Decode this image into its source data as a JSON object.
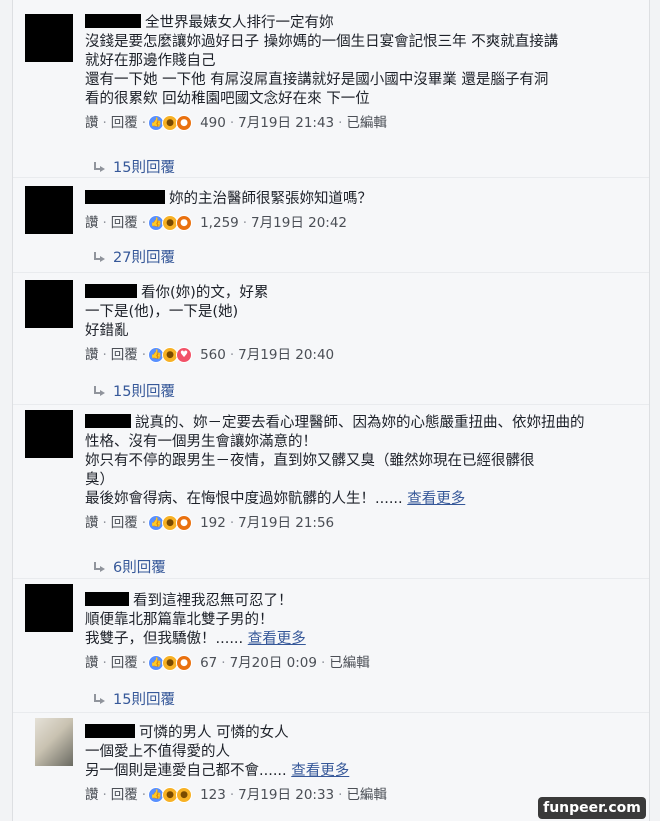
{
  "comments": [
    {
      "lines": [
        "全世界最婊女人排行一定有妳",
        "沒錢是要怎麼讓妳過好日子 操妳媽的一個生日宴會記恨三年 不爽就直接講",
        "就好在那邊作賤自己",
        "還有一下她 一下他 有屌沒屌直接講就好是國小國中沒畢業 還是腦子有洞",
        "看的很累欸 回幼稚園吧國文念好在來 下一位"
      ],
      "actions": {
        "like": "讚",
        "reply": "回覆",
        "count": "490",
        "time": "7月19日 21:43",
        "edited": "已編輯"
      },
      "reactions": [
        "like",
        "haha",
        "angry"
      ],
      "replies": "15則回覆"
    },
    {
      "lines": [
        "妳的主治醫師很緊張妳知道嗎？"
      ],
      "actions": {
        "like": "讚",
        "reply": "回覆",
        "count": "1,259",
        "time": "7月19日 20:42",
        "edited": ""
      },
      "reactions": [
        "like",
        "haha",
        "angry"
      ],
      "replies": "27則回覆"
    },
    {
      "lines": [
        "看你(妳)的文，好累",
        "一下是(他)，一下是(她)",
        "好錯亂"
      ],
      "actions": {
        "like": "讚",
        "reply": "回覆",
        "count": "560",
        "time": "7月19日 20:40",
        "edited": ""
      },
      "reactions": [
        "like",
        "haha",
        "love"
      ],
      "replies": "15則回覆"
    },
    {
      "lines": [
        "說真的、妳－定要去看心理醫師、因為妳的心態嚴重扭曲、依妳扭曲的",
        "性格、沒有一個男生會讓妳滿意的！",
        "妳只有不停的跟男生－夜情，直到妳又髒又臭（雖然妳現在已經很髒很",
        "臭）",
        "最後妳會得病、在悔恨中度過妳骯髒的人生！......"
      ],
      "see_more": "查看更多",
      "actions": {
        "like": "讚",
        "reply": "回覆",
        "count": "192",
        "time": "7月19日 21:56",
        "edited": ""
      },
      "reactions": [
        "like",
        "haha",
        "angry"
      ],
      "replies": "6則回覆"
    },
    {
      "lines": [
        "看到這裡我忍無可忍了！",
        "順便靠北那篇靠北雙子男的！",
        "我雙子，但我驕傲！......"
      ],
      "see_more": "查看更多",
      "actions": {
        "like": "讚",
        "reply": "回覆",
        "count": "67",
        "time": "7月20日 0:09",
        "edited": "已編輯"
      },
      "reactions": [
        "like",
        "haha",
        "angry"
      ],
      "replies": "15則回覆"
    },
    {
      "lines": [
        "可憐的男人 可憐的女人",
        "一個愛上不值得愛的人",
        "另一個則是連愛自己都不會......"
      ],
      "see_more": "查看更多",
      "actions": {
        "like": "讚",
        "reply": "回覆",
        "count": "123",
        "time": "7月19日 20:33",
        "edited": "已編輯"
      },
      "reactions": [
        "like",
        "haha",
        "wow"
      ],
      "replies": ""
    }
  ],
  "watermark": "funpeer.com",
  "colors": {
    "link": "#365899",
    "meta": "#4b4f56",
    "like": "#5890ff"
  }
}
